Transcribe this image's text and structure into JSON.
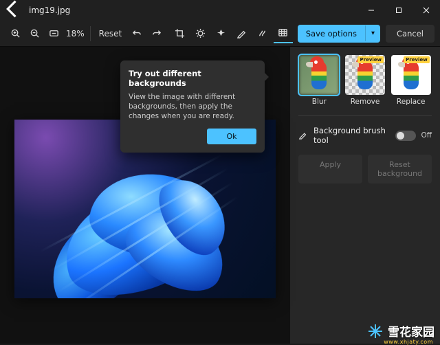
{
  "titlebar": {
    "filename": "img19.jpg"
  },
  "toolbar": {
    "zoom_pct": "18%",
    "reset": "Reset",
    "save_options": "Save options",
    "cancel": "Cancel"
  },
  "callout": {
    "title": "Try out different backgrounds",
    "body": "View the image with different backgrounds, then apply the changes when you are ready.",
    "ok": "Ok"
  },
  "panel": {
    "thumbs": [
      {
        "label": "Blur",
        "badge": null
      },
      {
        "label": "Remove",
        "badge": "Preview"
      },
      {
        "label": "Replace",
        "badge": "Preview"
      }
    ],
    "brush_label": "Background brush tool",
    "toggle_state": "Off",
    "apply": "Apply",
    "reset_bg": "Reset background"
  },
  "watermark": {
    "text": "雪花家园",
    "sub": "www.xhjaty.com"
  }
}
